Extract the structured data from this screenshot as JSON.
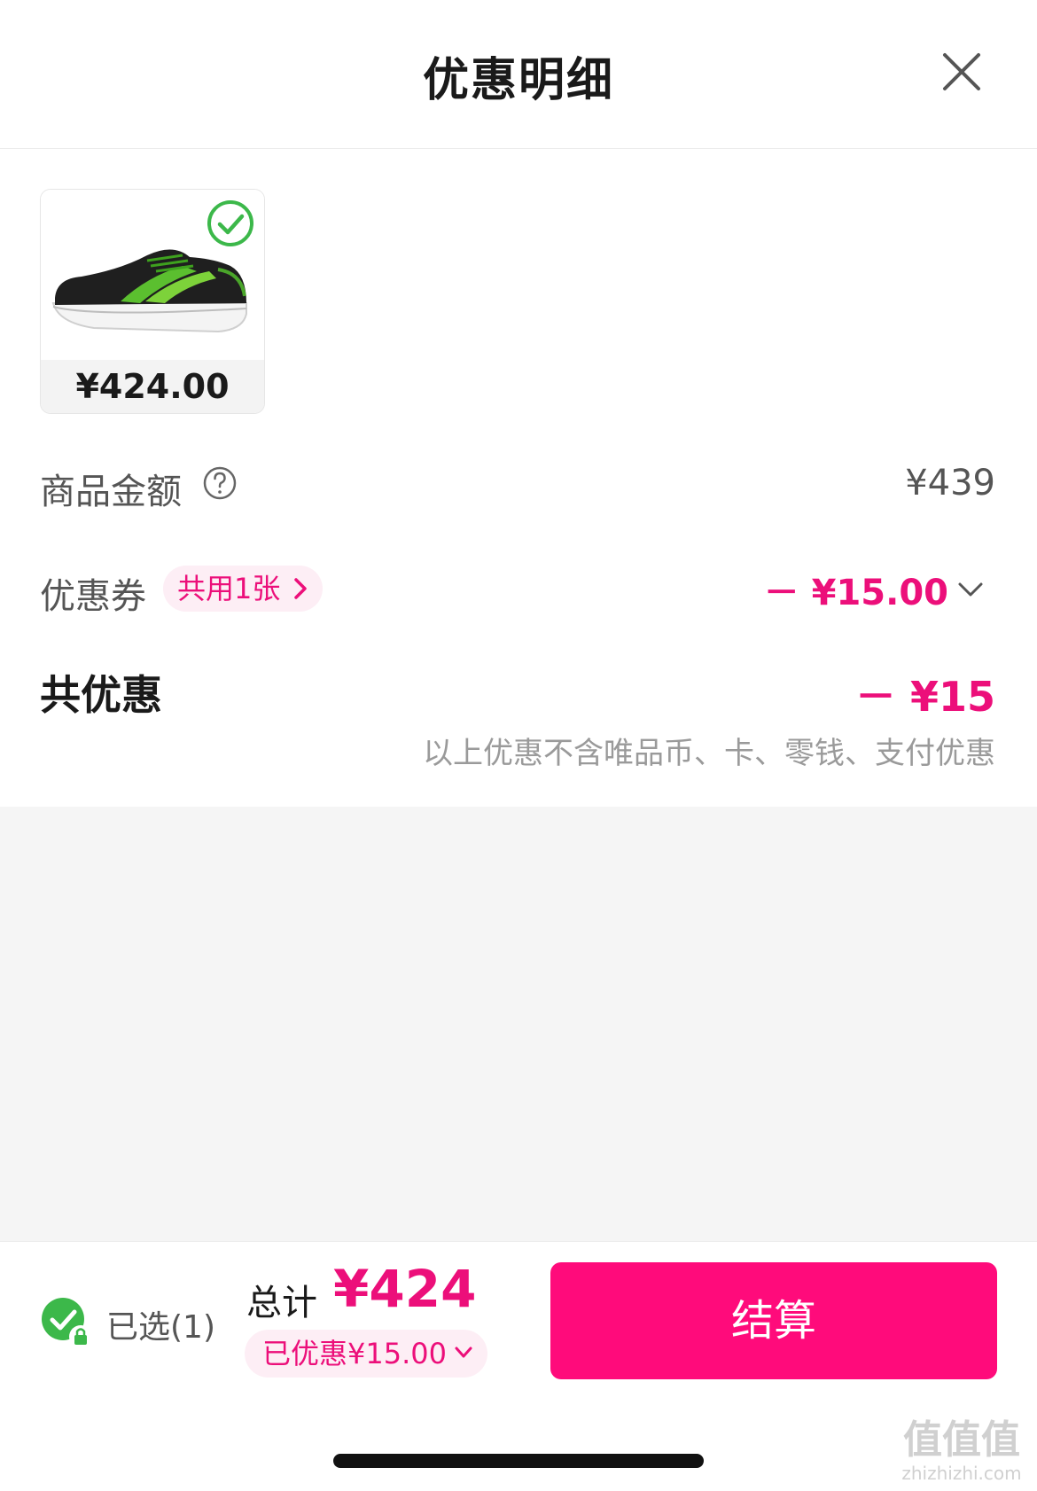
{
  "header": {
    "title": "优惠明细"
  },
  "product": {
    "price": "¥424.00",
    "image_alt": "running-shoe"
  },
  "rows": {
    "goods_amount_label": "商品金额",
    "goods_amount_value": "¥439",
    "coupon_label": "优惠券",
    "coupon_tag": "共用1张",
    "coupon_value": "－ ¥15.00",
    "total_discount_label": "共优惠",
    "total_discount_value": "－ ¥15",
    "discount_note": "以上优惠不含唯品币、卡、零钱、支付优惠"
  },
  "bottom": {
    "selected_text": "已选(1)",
    "total_label": "总计",
    "total_amount": "¥424",
    "saved_text": "已优惠¥15.00",
    "checkout_label": "结算"
  },
  "watermark": {
    "big": "值值值",
    "small": "zhizhizhi.com"
  },
  "colors": {
    "accent": "#ff0b7b",
    "accent_text": "#ec0f7a",
    "accent_bg": "#fdeef5",
    "check_green": "#3cb84a"
  },
  "icons": [
    "close-icon",
    "check-circle-icon",
    "help-circle-icon",
    "chevron-right-icon",
    "chevron-down-icon",
    "lock-icon"
  ]
}
